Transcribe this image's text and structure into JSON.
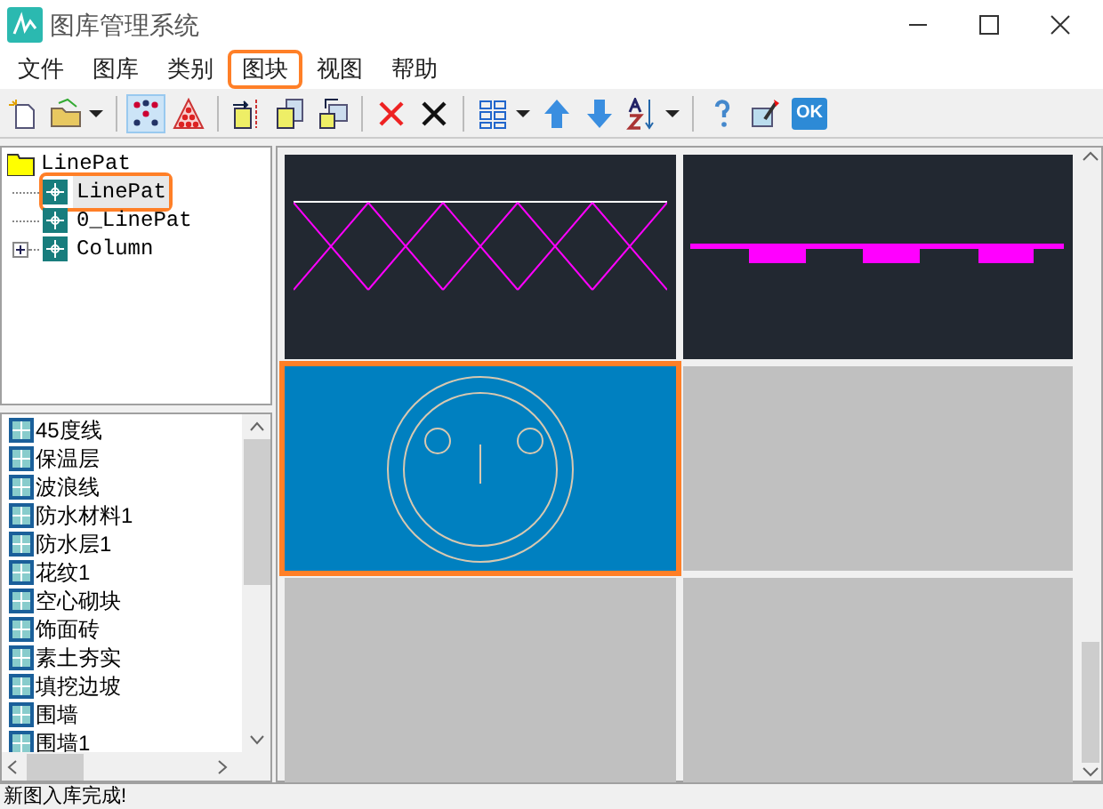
{
  "window": {
    "title": "图库管理系统"
  },
  "menu": [
    {
      "label": "文件",
      "highlighted": false
    },
    {
      "label": "图库",
      "highlighted": false
    },
    {
      "label": "类别",
      "highlighted": false
    },
    {
      "label": "图块",
      "highlighted": true
    },
    {
      "label": "视图",
      "highlighted": false
    },
    {
      "label": "帮助",
      "highlighted": false
    }
  ],
  "toolbar": {
    "buttons": [
      {
        "pressed": false
      },
      {
        "pressed": false
      },
      {
        "pressed": true
      },
      {
        "pressed": false
      }
    ],
    "ok_label": "OK"
  },
  "tree": {
    "label": "LinePat",
    "expanded": true,
    "children": [
      {
        "label": "LinePat",
        "selected": true,
        "highlighted": true,
        "expandable": false
      },
      {
        "label": "0_LinePat",
        "selected": false,
        "highlighted": false,
        "expandable": false
      },
      {
        "label": "Column",
        "selected": false,
        "highlighted": false,
        "expandable": true
      }
    ]
  },
  "list": [
    "45度线",
    "保温层",
    "波浪线",
    "防水材料1",
    "防水层1",
    "花纹1",
    "空心砌块",
    "饰面砖",
    "素土夯实",
    "填挖边坡",
    "围墙",
    "围墙1"
  ],
  "tiles": [
    {
      "kind": "crosshatch",
      "selected": false,
      "highlighted": false
    },
    {
      "kind": "slab",
      "selected": false,
      "highlighted": false
    },
    {
      "kind": "circles",
      "selected": true,
      "highlighted": true
    },
    {
      "kind": "empty",
      "selected": false,
      "highlighted": false
    },
    {
      "kind": "empty",
      "selected": false,
      "highlighted": false
    },
    {
      "kind": "empty",
      "selected": false,
      "highlighted": false
    }
  ],
  "status_bar": "新图入库完成!"
}
